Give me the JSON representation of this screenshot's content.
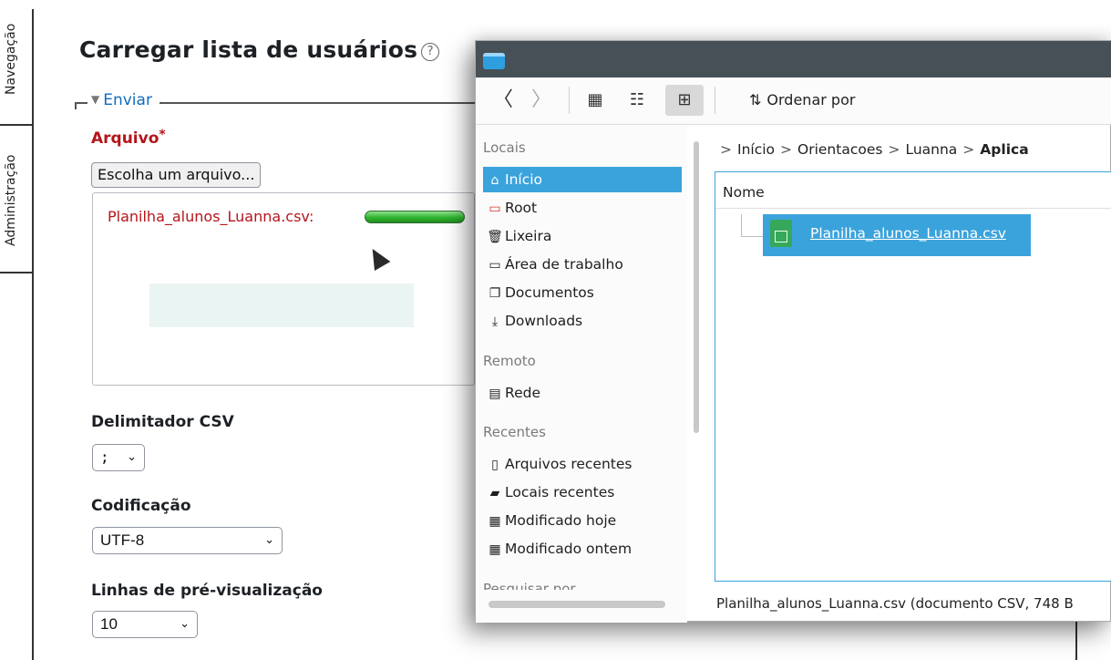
{
  "left_tabs": [
    "Navegação",
    "Administração"
  ],
  "form": {
    "title": "Carregar lista de usuários",
    "help_icon": "question-circle-icon",
    "legend": "Enviar",
    "file_label": "Arquivo",
    "required_mark": "*",
    "choose_button": "Escolha um arquivo...",
    "uploading_file": "Planilha_alunos_Luanna.csv:",
    "upload_progress": 1.0,
    "csv_delimiter_label": "Delimitador CSV",
    "csv_delimiter_value": ";",
    "encoding_label": "Codificação",
    "encoding_value": "UTF-8",
    "preview_rows_label": "Linhas de pré-visualização",
    "preview_rows_value": "10"
  },
  "dialog": {
    "toolbar": {
      "back_icon": "chevron-left-icon",
      "forward_icon": "chevron-right-icon",
      "icons_view_icon": "grid-view-icon",
      "compact_view_icon": "list-view-icon",
      "tree_view_icon": "tree-view-icon",
      "sort_label": "Ordenar por"
    },
    "sidebar": {
      "places_heading": "Locais",
      "places": [
        {
          "label": "Início",
          "icon": "home-icon",
          "selected": true
        },
        {
          "label": "Root",
          "icon": "folder-red-icon"
        },
        {
          "label": "Lixeira",
          "icon": "trash-icon"
        },
        {
          "label": "Área de trabalho",
          "icon": "desktop-icon"
        },
        {
          "label": "Documentos",
          "icon": "documents-icon"
        },
        {
          "label": "Downloads",
          "icon": "download-icon"
        }
      ],
      "remote_heading": "Remoto",
      "remote": [
        {
          "label": "Rede",
          "icon": "network-icon"
        }
      ],
      "recent_heading": "Recentes",
      "recent": [
        {
          "label": "Arquivos recentes",
          "icon": "recent-files-icon"
        },
        {
          "label": "Locais recentes",
          "icon": "recent-locations-icon"
        },
        {
          "label": "Modificado hoje",
          "icon": "calendar-icon"
        },
        {
          "label": "Modificado ontem",
          "icon": "calendar-icon"
        }
      ],
      "search_heading": "Pesquisar por"
    },
    "breadcrumb": [
      "Início",
      "Orientacoes",
      "Luanna",
      "Aplica"
    ],
    "column_header": "Nome",
    "files": [
      {
        "name": "Planilha_alunos_Luanna.csv",
        "icon": "spreadsheet-icon",
        "selected": true
      }
    ],
    "status": "Planilha_alunos_Luanna.csv (documento CSV, 748 B"
  }
}
